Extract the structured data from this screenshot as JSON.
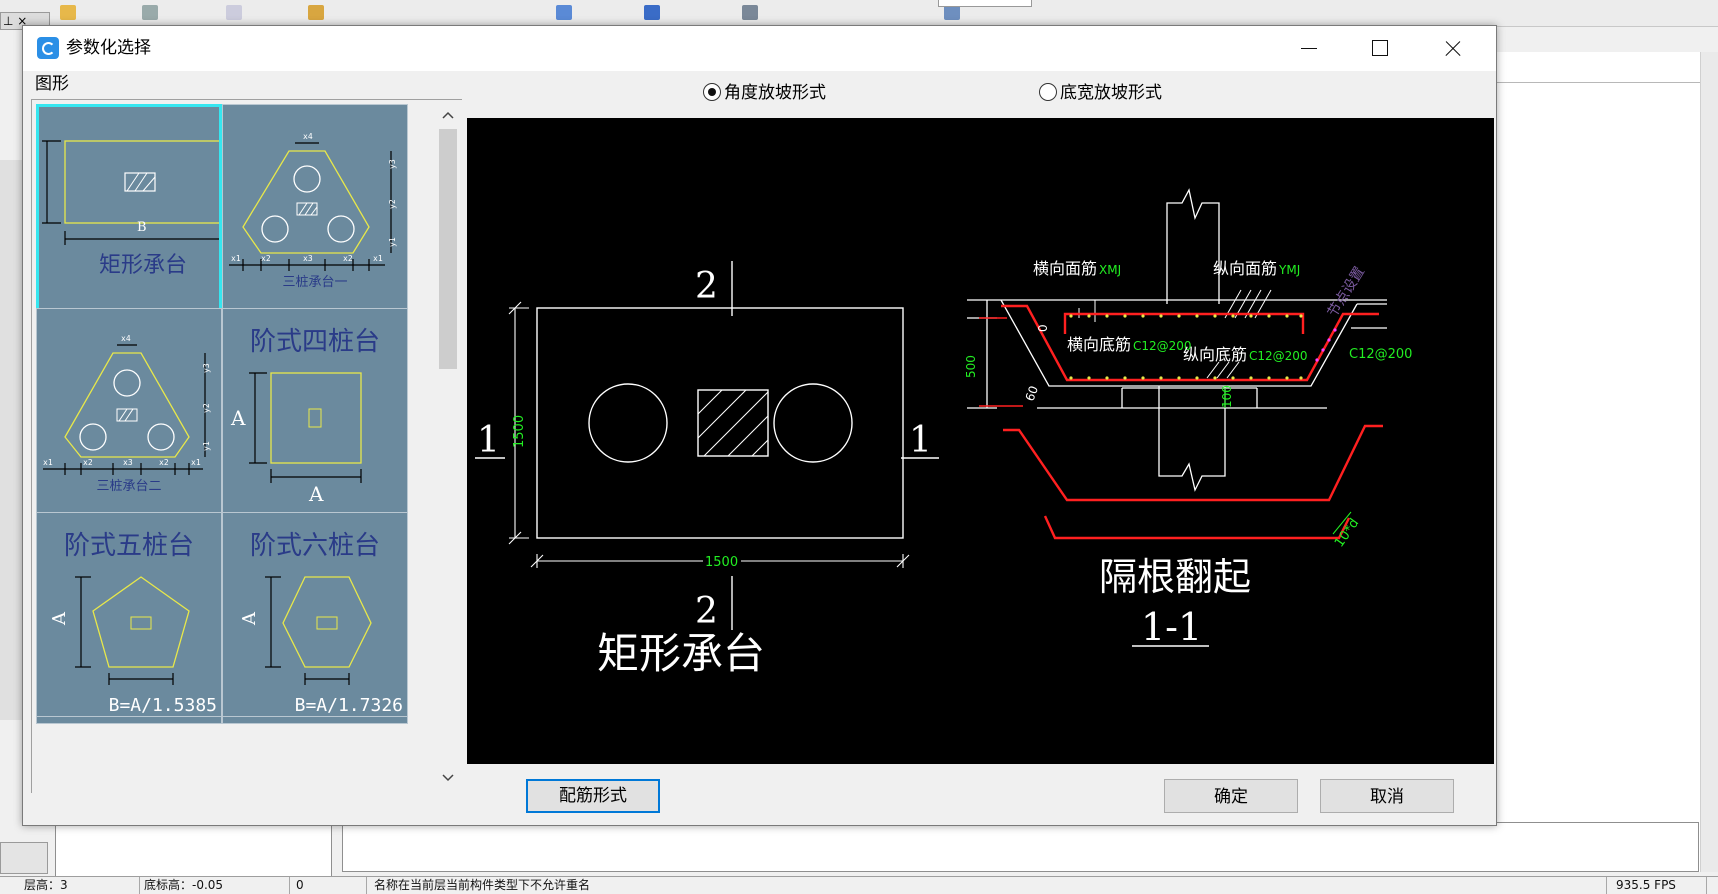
{
  "dialog": {
    "title": "参数化选择",
    "group_label": "图形",
    "thumbnails": [
      {
        "label": "矩形承台",
        "sublabel": "B",
        "selected": true
      },
      {
        "label": "三桩承台一"
      },
      {
        "label": "三桩承台二"
      },
      {
        "label": "阶式四桩台",
        "dim_a": "A"
      },
      {
        "label": "阶式五桩台",
        "formula": "B=A/1.5385"
      },
      {
        "label": "阶式六桩台",
        "formula": "B=A/1.7326"
      }
    ],
    "radio": {
      "option1": "角度放坡形式",
      "option2": "底宽放坡形式",
      "selected": "option1"
    },
    "buttons": {
      "rebar": "配筋形式",
      "ok": "确定",
      "cancel": "取消"
    }
  },
  "drawing": {
    "plan": {
      "title": "矩形承台",
      "section_mark": "2",
      "side_mark": "1",
      "width_dim": "1500",
      "height_dim": "1500"
    },
    "section": {
      "title_line1": "隔根翻起",
      "title_line2": "1-1",
      "top_transverse": "横向面筋",
      "top_transverse_code": "XMJ",
      "top_longitudinal": "纵向面筋",
      "top_longitudinal_code": "YMJ",
      "bottom_transverse": "横向底筋",
      "bottom_transverse_spec": "C12@200",
      "bottom_longitudinal": "纵向底筋",
      "bottom_longitudinal_spec": "C12@200",
      "side_spec": "C12@200",
      "side_note": "节点设置",
      "depth": "500",
      "cover": "100",
      "zero": "0",
      "angle": "60",
      "bend": "10*d"
    }
  },
  "status_bar": [
    "层高：3",
    "底标高：-0.05",
    "0",
    "名称在当前层当前构件类型下不允许重名",
    "",
    "935.5 FPS"
  ],
  "colors": {
    "thumb_bg": "#6b8a9e",
    "thumb_selected": "#35e6f0",
    "cad_red": "#ff2020",
    "cad_green": "#22ee22",
    "cad_yellow": "#e8e84a"
  }
}
